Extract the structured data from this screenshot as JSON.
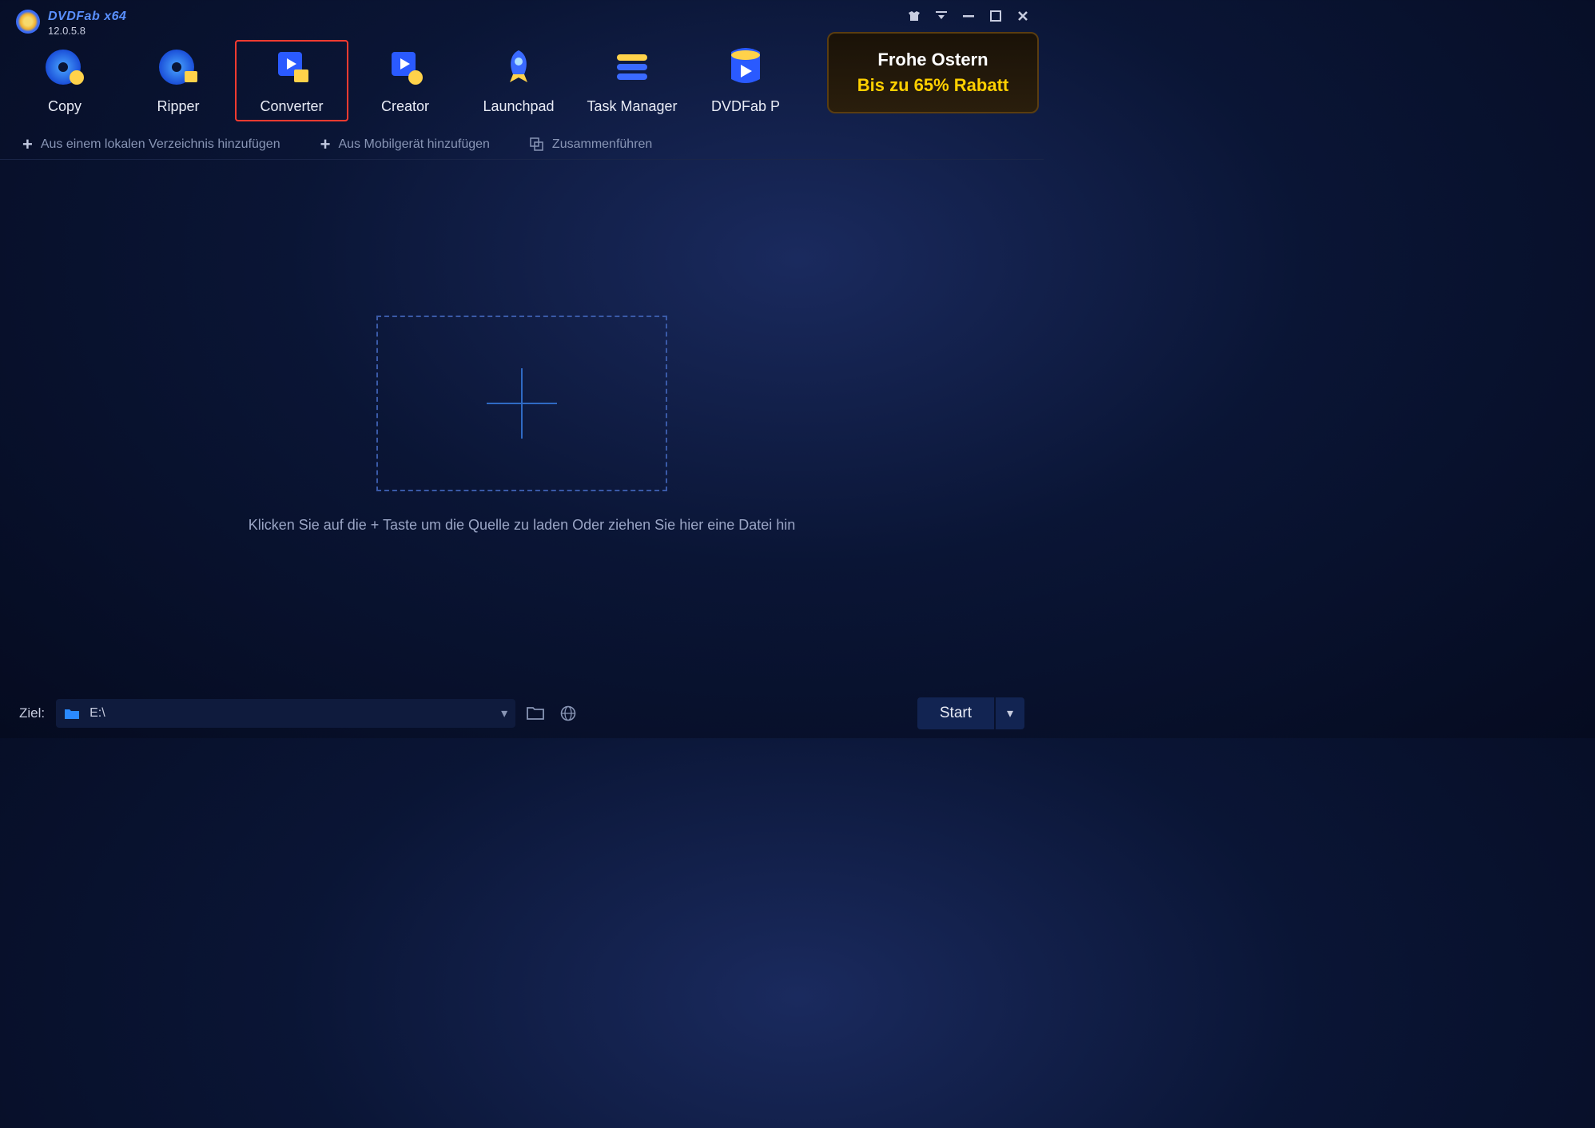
{
  "app": {
    "title_brand": "DVDFab",
    "title_arch": "x64",
    "version": "12.0.5.8"
  },
  "tabs": [
    {
      "label": "Copy"
    },
    {
      "label": "Ripper"
    },
    {
      "label": "Converter"
    },
    {
      "label": "Creator"
    },
    {
      "label": "Launchpad"
    },
    {
      "label": "Task Manager"
    },
    {
      "label": "DVDFab P"
    }
  ],
  "promo": {
    "line1": "Frohe Ostern",
    "line2": "Bis zu 65% Rabatt"
  },
  "actions": {
    "add_local": "Aus einem lokalen Verzeichnis hinzufügen",
    "add_mobile": "Aus Mobilgerät hinzufügen",
    "merge": "Zusammenführen"
  },
  "dropzone": {
    "hint": "Klicken Sie auf die + Taste um die Quelle zu laden Oder ziehen Sie hier eine Datei hin"
  },
  "footer": {
    "dest_label": "Ziel:",
    "dest_path": "E:\\",
    "start_label": "Start"
  }
}
